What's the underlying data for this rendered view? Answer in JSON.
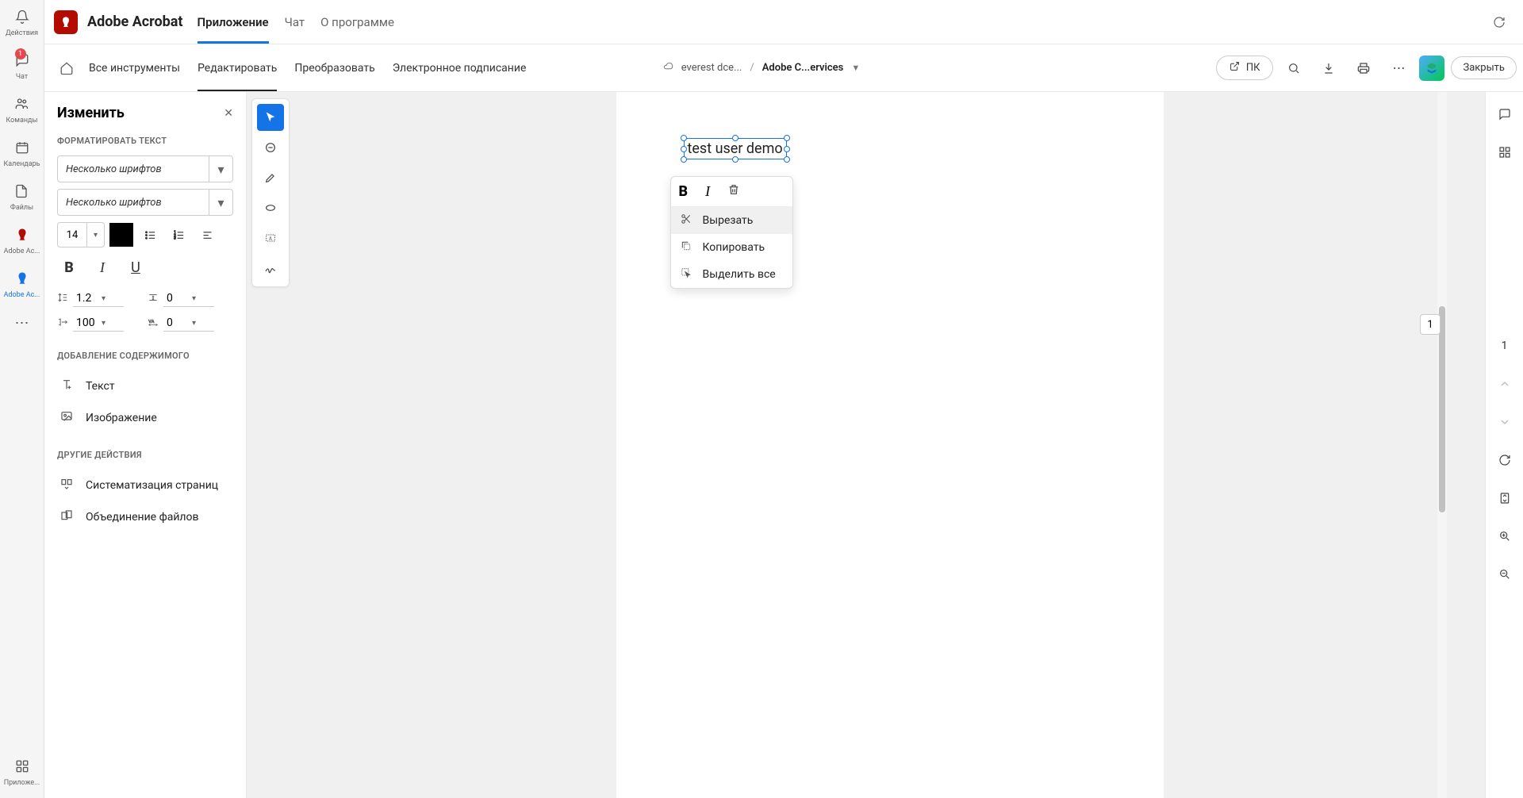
{
  "far_left": {
    "actions": "Действия",
    "chat": "Чат",
    "chat_badge": "1",
    "teams": "Команды",
    "calendar": "Календарь",
    "files": "Файлы",
    "acrobat1": "Adobe Ac...",
    "acrobat2": "Adobe Ac...",
    "apps": "Приложе..."
  },
  "header": {
    "app_name": "Adobe Acrobat",
    "tabs": {
      "app": "Приложение",
      "chat": "Чат",
      "about": "О программе"
    }
  },
  "sub_header": {
    "all_tools": "Все инструменты",
    "edit": "Редактировать",
    "convert": "Преобразовать",
    "esign": "Электронное подписание",
    "breadcrumb_cloud": "everest dce...",
    "breadcrumb_doc": "Adobe C...ervices",
    "pc_label": "ПК",
    "close": "Закрыть"
  },
  "edit_panel": {
    "title": "Изменить",
    "format_label": "ФОРМАТИРОВАТЬ ТЕКСТ",
    "font1": "Несколько шрифтов",
    "font2": "Несколько шрифтов",
    "size": "14",
    "line_height": "1.2",
    "para_spacing": "0",
    "scale": "100",
    "tracking": "0",
    "add_content_label": "ДОБАВЛЕНИЕ СОДЕРЖИМОГО",
    "add_text": "Текст",
    "add_image": "Изображение",
    "other_label": "ДРУГИЕ ДЕЙСТВИЯ",
    "organize": "Систематизация страниц",
    "combine": "Объединение файлов"
  },
  "document": {
    "text_content": "test user demo"
  },
  "context_menu": {
    "cut": "Вырезать",
    "copy": "Копировать",
    "select_all": "Выделить все"
  },
  "page_numbers": {
    "current": "1",
    "total": "1"
  }
}
